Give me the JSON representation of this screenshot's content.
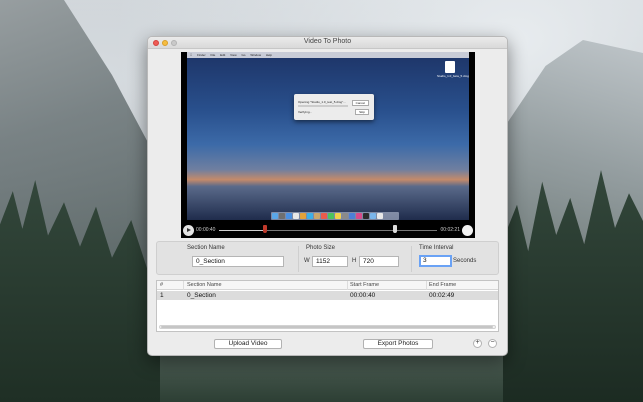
{
  "window": {
    "title": "Video To Photo"
  },
  "player": {
    "current_time": "00:00:40",
    "end_time": "00:02:21",
    "screen": {
      "menubar_items": [
        "Finder",
        "File",
        "Edit",
        "View",
        "Go",
        "Window",
        "Help"
      ],
      "dialog_title": "Opening \"Studio_1.0_test_5.dmg\"...",
      "dialog_status": "Verifying...",
      "dialog_cancel": "Cancel",
      "dialog_stop": "Skip",
      "desktop_file_label": "Studio_1.0_beta_5.dmg"
    }
  },
  "settings": {
    "section_name_label": "Section Name",
    "section_name_value": "0_Section",
    "photo_size_label": "Photo Size",
    "width_label": "W",
    "width_value": "1152",
    "height_label": "H",
    "height_value": "720",
    "time_interval_label": "Time Interval",
    "time_interval_value": "3",
    "time_interval_unit": "Seconds"
  },
  "table": {
    "headers": {
      "num": "#",
      "section_name": "Section Name",
      "start_frame": "Start Frame",
      "end_frame": "End Frame"
    },
    "rows": [
      {
        "num": "1",
        "section_name": "0_Section",
        "start_frame": "00:00:40",
        "end_frame": "00:02:49"
      }
    ]
  },
  "toolbar": {
    "upload_label": "Upload Video",
    "export_label": "Export Photos",
    "add_label": "+",
    "remove_label": "−"
  },
  "colors": {
    "accent_focus": "#6aa2f5",
    "start_marker": "#c0392b",
    "close": "#ee5b55",
    "minimize": "#f5bd40"
  }
}
